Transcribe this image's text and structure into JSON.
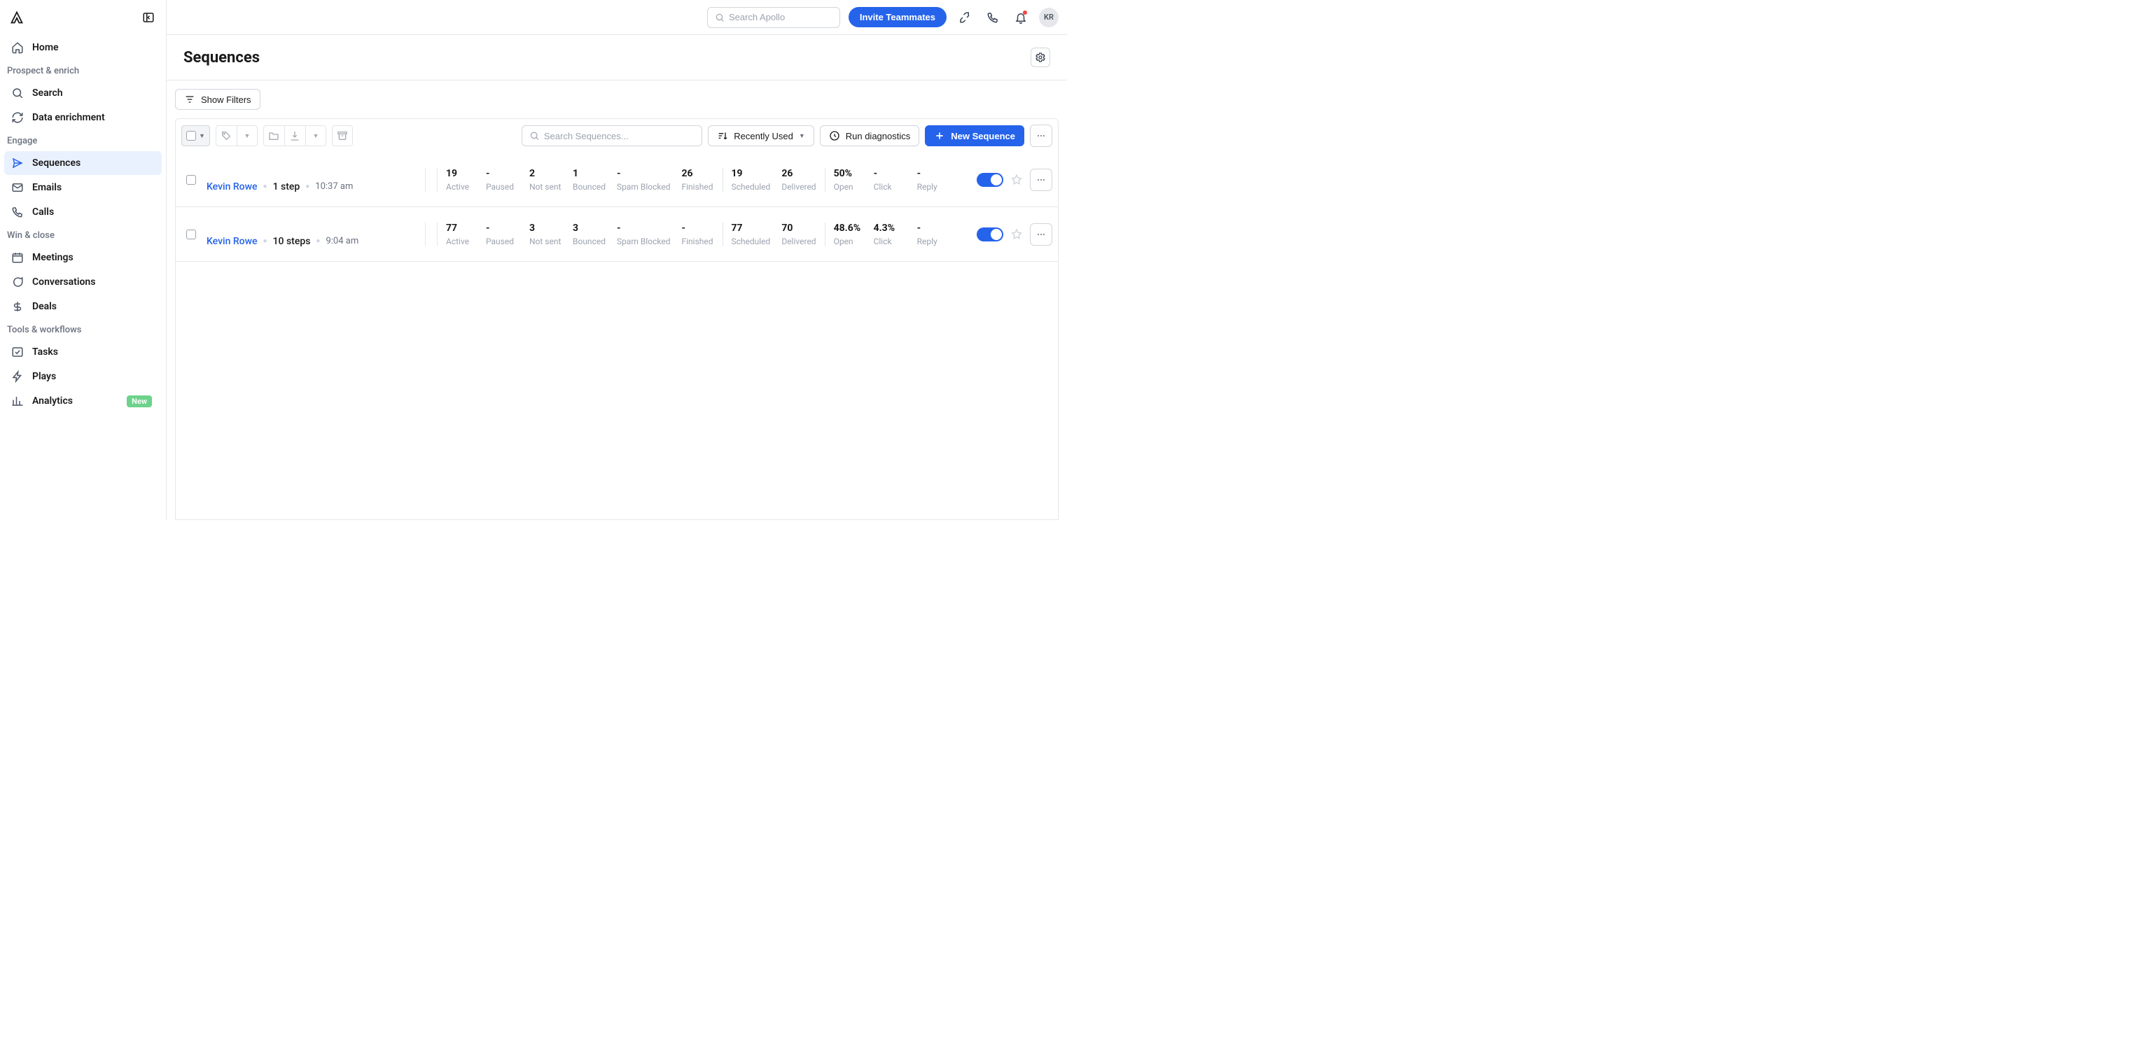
{
  "topbar": {
    "search_placeholder": "Search Apollo",
    "invite_label": "Invite Teammates",
    "avatar_initials": "KR"
  },
  "sidebar": {
    "home": "Home",
    "sections": [
      {
        "label": "Prospect & enrich",
        "items": [
          {
            "label": "Search",
            "icon": "search"
          },
          {
            "label": "Data enrichment",
            "icon": "refresh"
          }
        ]
      },
      {
        "label": "Engage",
        "items": [
          {
            "label": "Sequences",
            "icon": "send",
            "active": true
          },
          {
            "label": "Emails",
            "icon": "mail"
          },
          {
            "label": "Calls",
            "icon": "phone"
          }
        ]
      },
      {
        "label": "Win & close",
        "items": [
          {
            "label": "Meetings",
            "icon": "calendar"
          },
          {
            "label": "Conversations",
            "icon": "chat"
          },
          {
            "label": "Deals",
            "icon": "dollar"
          }
        ]
      },
      {
        "label": "Tools & workflows",
        "items": [
          {
            "label": "Tasks",
            "icon": "check"
          },
          {
            "label": "Plays",
            "icon": "bolt"
          },
          {
            "label": "Analytics",
            "icon": "bars",
            "badge": "New"
          }
        ]
      }
    ]
  },
  "page": {
    "title": "Sequences",
    "show_filters": "Show Filters",
    "search_placeholder": "Search Sequences...",
    "sort_label": "Recently Used",
    "diagnostics_label": "Run diagnostics",
    "new_sequence_label": "New Sequence"
  },
  "sequences": [
    {
      "owner": "Kevin Rowe",
      "steps": "1 step",
      "time": "10:37 am",
      "stats": {
        "active": "19",
        "paused": "-",
        "not_sent": "2",
        "bounced": "1",
        "spam_blocked": "-",
        "finished": "26",
        "scheduled": "19",
        "delivered": "26",
        "open": "50%",
        "click": "-",
        "reply": "-"
      },
      "enabled": true
    },
    {
      "owner": "Kevin Rowe",
      "steps": "10 steps",
      "time": "9:04 am",
      "stats": {
        "active": "77",
        "paused": "-",
        "not_sent": "3",
        "bounced": "3",
        "spam_blocked": "-",
        "finished": "-",
        "scheduled": "77",
        "delivered": "70",
        "open": "48.6%",
        "click": "4.3%",
        "reply": "-"
      },
      "enabled": true
    }
  ],
  "stat_labels": {
    "active": "Active",
    "paused": "Paused",
    "not_sent": "Not sent",
    "bounced": "Bounced",
    "spam_blocked": "Spam Blocked",
    "finished": "Finished",
    "scheduled": "Scheduled",
    "delivered": "Delivered",
    "open": "Open",
    "click": "Click",
    "reply": "Reply"
  }
}
